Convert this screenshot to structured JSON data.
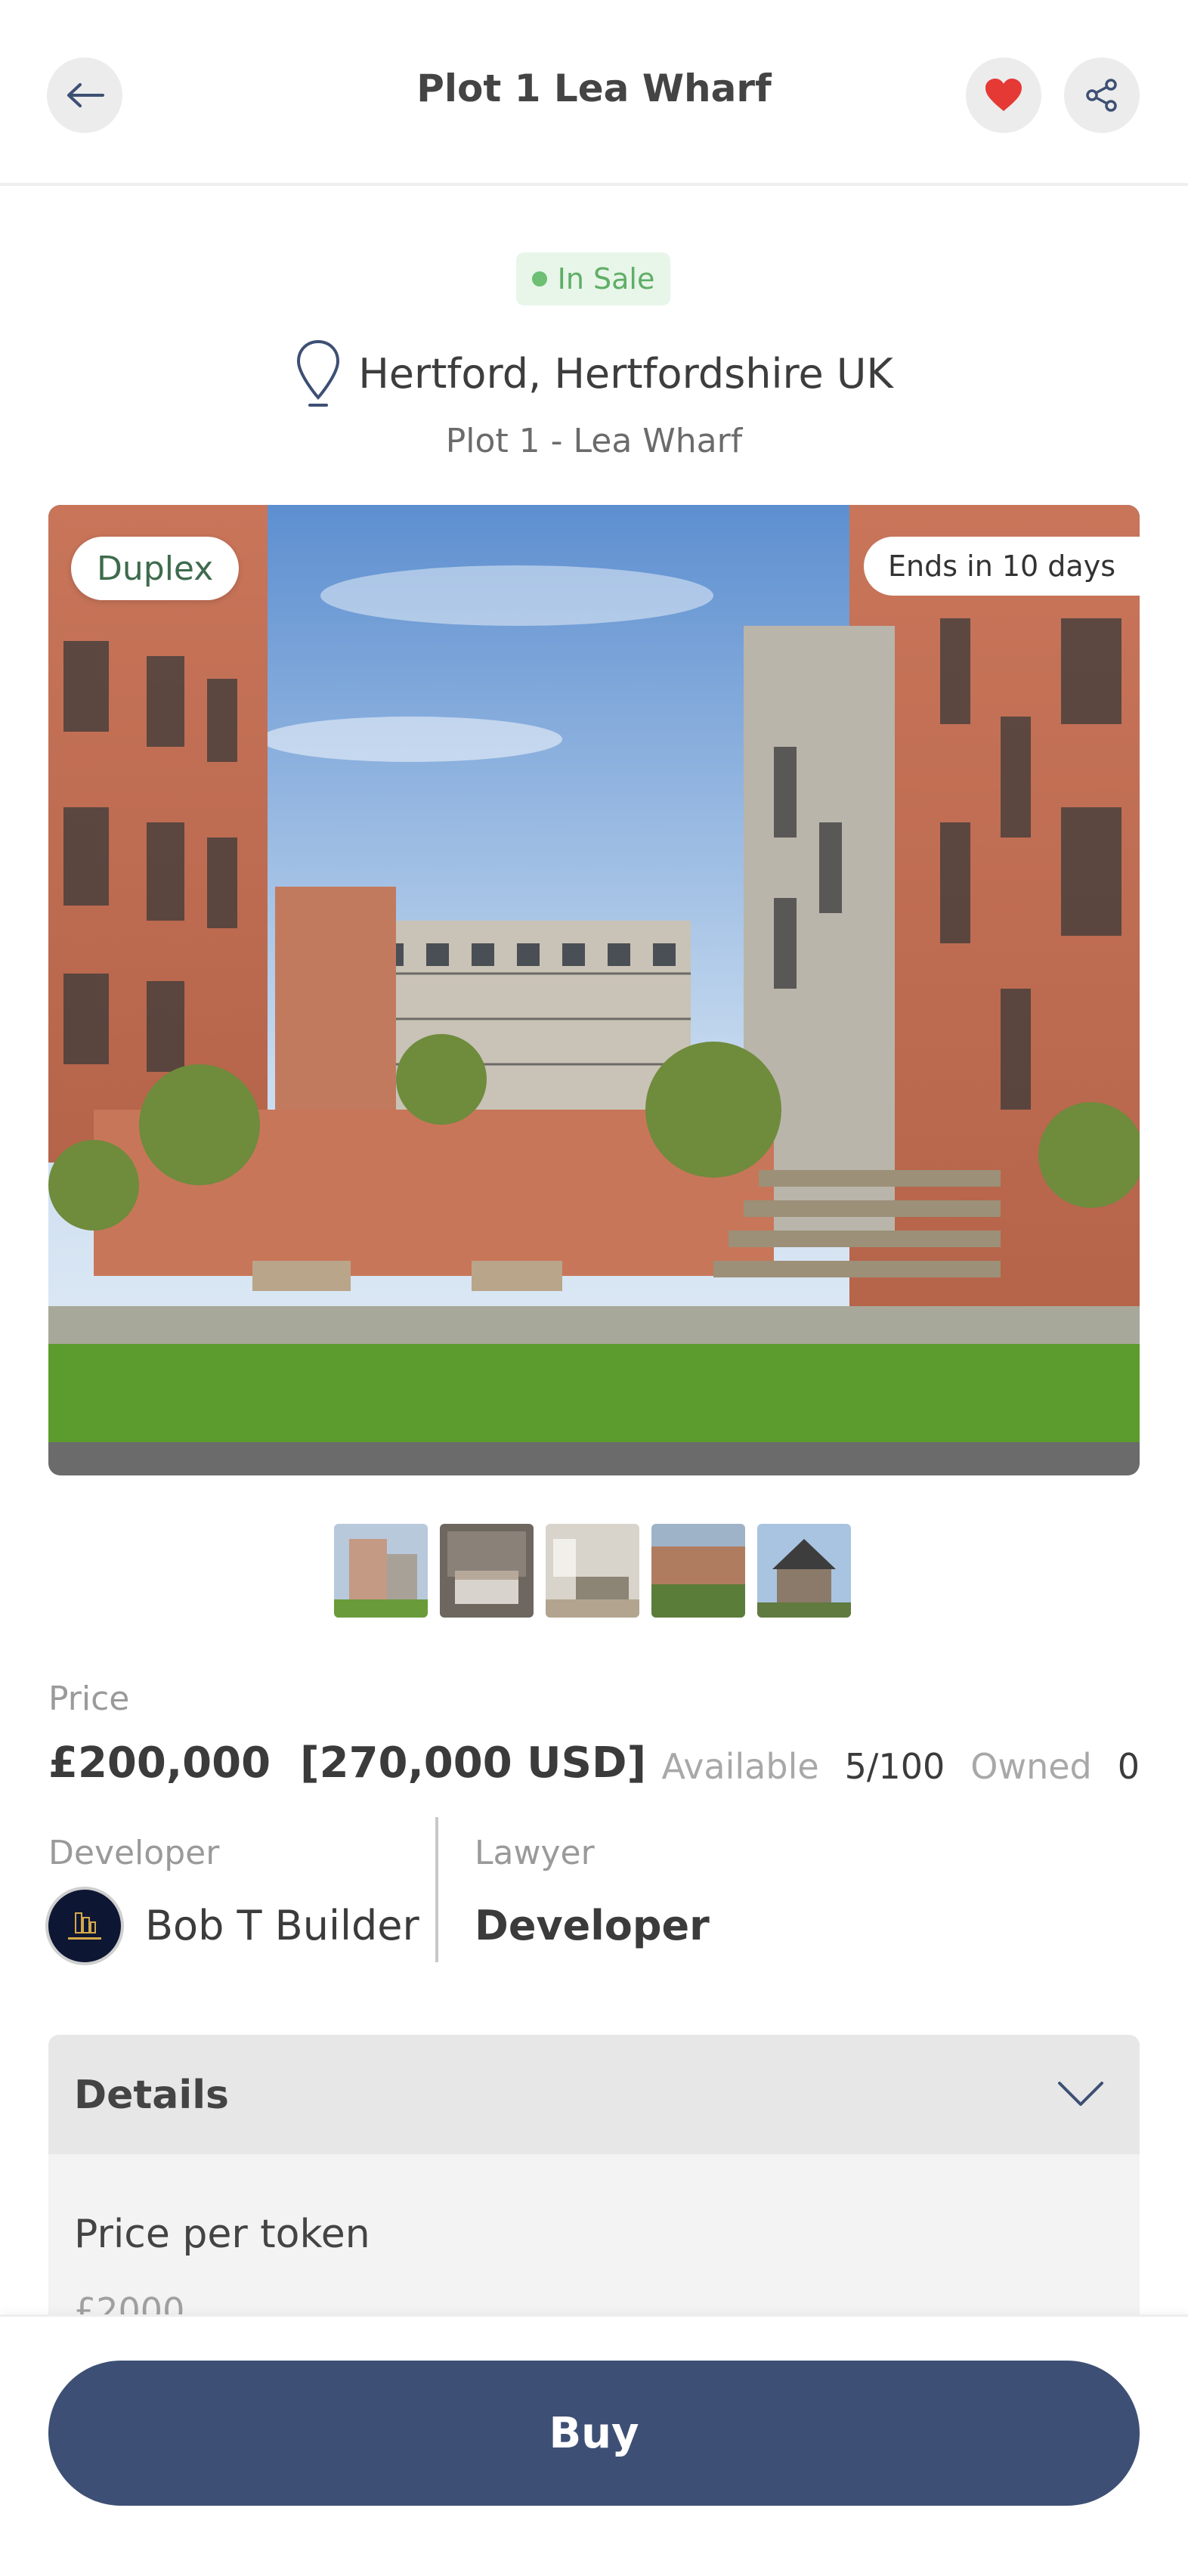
{
  "header": {
    "title": "Plot 1 Lea Wharf",
    "icons": {
      "back": "arrow-left-icon",
      "favorite": "heart-icon",
      "share": "share-icon"
    }
  },
  "listing": {
    "status": "In Sale",
    "location": "Hertford, Hertfordshire UK",
    "sublocation": "Plot 1 - Lea Wharf",
    "type_badge": "Duplex",
    "ends_badge": "Ends in 10 days",
    "thumbnail_count": 5
  },
  "pricing": {
    "price_label": "Price",
    "price_value": "£200,000  [270,000 USD]",
    "available_label": "Available",
    "available_value": "5/100",
    "owned_label": "Owned",
    "owned_value": "0"
  },
  "parties": {
    "developer_label": "Developer",
    "developer_name": "Bob T Builder",
    "lawyer_label": "Lawyer",
    "lawyer_name": "Developer"
  },
  "details": {
    "title": "Details",
    "price_per_token_label": "Price per token",
    "price_per_token_value": "£2000"
  },
  "actions": {
    "buy_label": "Buy"
  },
  "colors": {
    "primary": "#3d4f74",
    "favorite": "#e53935",
    "status_green": "#5fae66",
    "status_bg": "#e8f5e9"
  }
}
